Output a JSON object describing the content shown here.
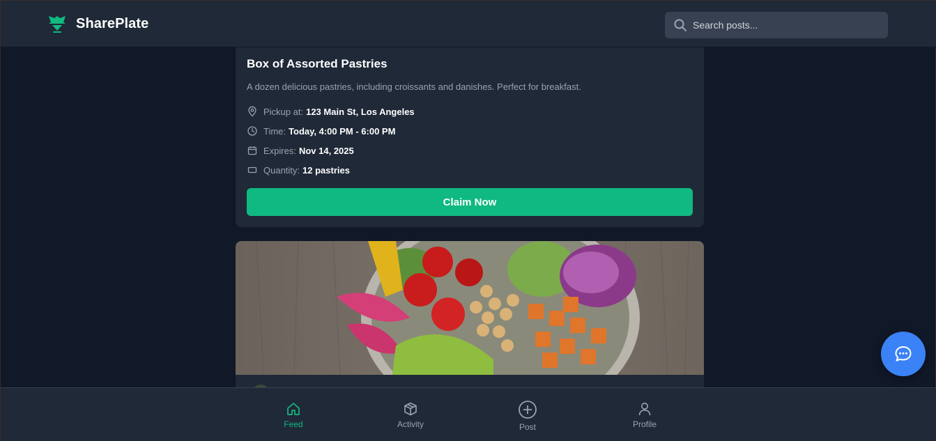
{
  "header": {
    "brand_name": "SharePlate",
    "logo_icon": "shareplate-logo-icon",
    "search_placeholder": "Search posts..."
  },
  "feed": {
    "posts": [
      {
        "title": "Box of Assorted Pastries",
        "description": "A dozen delicious pastries, including croissants and danishes. Perfect for breakfast.",
        "details": [
          {
            "icon": "map-pin-icon",
            "label": "Pickup at:",
            "value": "123 Main St, Los Angeles"
          },
          {
            "icon": "clock-icon",
            "label": "Time:",
            "value": "Today, 4:00 PM - 6:00 PM"
          },
          {
            "icon": "calendar-icon",
            "label": "Expires:",
            "value": "Nov 14, 2025"
          },
          {
            "icon": "box-icon",
            "label": "Quantity:",
            "value": "12 pastries"
          }
        ],
        "claim_label": "Claim Now"
      },
      {
        "image": "salad-bowl-photo"
      }
    ]
  },
  "bottom_nav": {
    "items": [
      {
        "label": "Feed",
        "icon": "home-icon",
        "active": true
      },
      {
        "label": "Activity",
        "icon": "package-icon",
        "active": false
      },
      {
        "label": "Post",
        "icon": "plus-circle-icon",
        "active": false
      },
      {
        "label": "Profile",
        "icon": "user-icon",
        "active": false
      }
    ]
  },
  "colors": {
    "accent": "#10b981",
    "background": "#111827",
    "surface": "#1f2937",
    "chat_button": "#3b82f6"
  },
  "chat_button_icon": "chat-bubble-icon"
}
